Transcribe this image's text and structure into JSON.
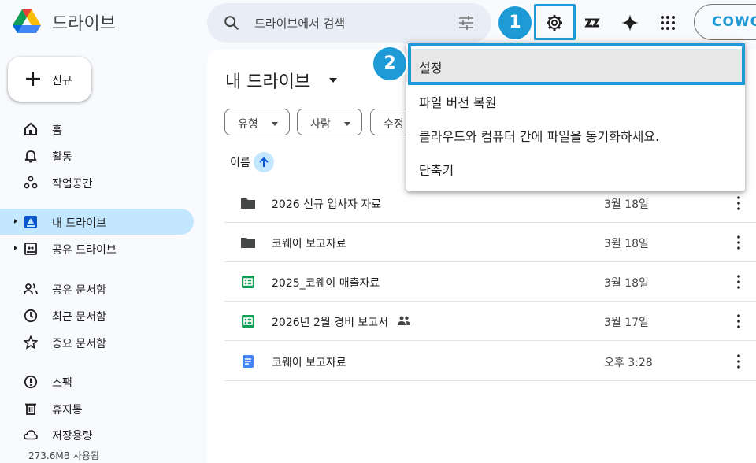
{
  "app": {
    "brand": "드라이브"
  },
  "search": {
    "placeholder": "드라이브에서 검색"
  },
  "annotations": {
    "step1": "1",
    "step2": "2"
  },
  "toolbar": {
    "account_label": "COWO"
  },
  "sidebar": {
    "new_label": "신규",
    "items": [
      {
        "label": "홈",
        "icon": "home-icon"
      },
      {
        "label": "활동",
        "icon": "bell-icon"
      },
      {
        "label": "작업공간",
        "icon": "workspaces-icon"
      },
      {
        "label": "내 드라이브",
        "icon": "my-drive-icon",
        "active": true
      },
      {
        "label": "공유 드라이브",
        "icon": "shared-drive-icon"
      },
      {
        "label": "공유 문서함",
        "icon": "people-icon"
      },
      {
        "label": "최근 문서함",
        "icon": "clock-icon"
      },
      {
        "label": "중요 문서함",
        "icon": "star-icon"
      },
      {
        "label": "스팸",
        "icon": "spam-icon"
      },
      {
        "label": "휴지통",
        "icon": "trash-icon"
      },
      {
        "label": "저장용량",
        "icon": "cloud-icon"
      }
    ],
    "storage_used": "273.6MB 사용됨"
  },
  "main": {
    "title": "내 드라이브",
    "filters": [
      "유형",
      "사람",
      "수정"
    ],
    "column_name": "이름",
    "files": [
      {
        "name": "2026 신규 입사자 자료",
        "type": "folder",
        "date": "3월 18일",
        "shared": false
      },
      {
        "name": "코웨이 보고자료",
        "type": "folder",
        "date": "3월 18일",
        "shared": false
      },
      {
        "name": "2025_코웨이 매출자료",
        "type": "sheet",
        "date": "3월 18일",
        "shared": false
      },
      {
        "name": "2026년 2월 경비 보고서",
        "type": "sheet",
        "date": "3월 17일",
        "shared": true
      },
      {
        "name": "코웨이 보고자료",
        "type": "doc",
        "date": "오후 3:28",
        "shared": false
      }
    ]
  },
  "settings_menu": {
    "items": [
      "설정",
      "파일 버전 복원",
      "클라우드와 컴퓨터 간에 파일을 동기화하세요.",
      "단축키"
    ]
  },
  "colors": {
    "accent": "#1e9ad6",
    "active_bg": "#c2e7ff",
    "search_bg": "#e9eef6",
    "page_bg": "#f8fafd"
  }
}
